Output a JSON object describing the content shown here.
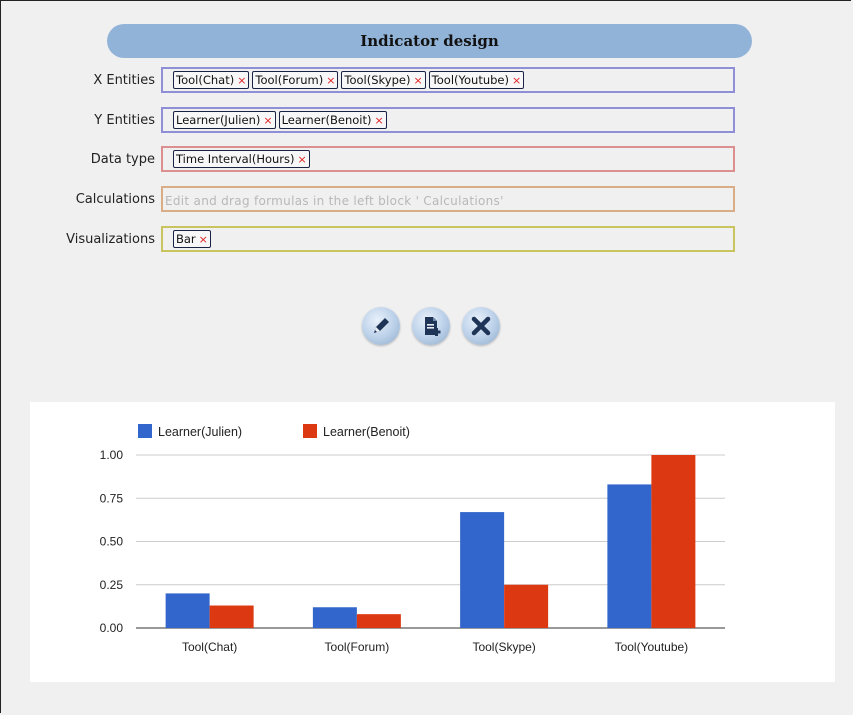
{
  "header": {
    "title": "Indicator design"
  },
  "form": {
    "x_entities": {
      "label": "X Entities",
      "tags": [
        "Tool(Chat)",
        "Tool(Forum)",
        "Tool(Skype)",
        "Tool(Youtube)"
      ]
    },
    "y_entities": {
      "label": "Y Entities",
      "tags": [
        "Learner(Julien)",
        "Learner(Benoit)"
      ]
    },
    "data_type": {
      "label": "Data type",
      "tags": [
        "Time Interval(Hours)"
      ]
    },
    "calculations": {
      "label": "Calculations",
      "placeholder": "Edit and drag formulas in the left block ' Calculations'"
    },
    "visualizations": {
      "label": "Visualizations",
      "tags": [
        "Bar"
      ]
    },
    "tag_remove_glyph": "×"
  },
  "actions": {
    "edit_icon": "pencil-icon",
    "save_icon": "document-add-icon",
    "delete_icon": "close-x-icon"
  },
  "colors": {
    "header_bg": "#92b3d8",
    "series_1": "#3366cc",
    "series_2": "#dc3912"
  },
  "chart_data": {
    "type": "bar",
    "categories": [
      "Tool(Chat)",
      "Tool(Forum)",
      "Tool(Skype)",
      "Tool(Youtube)"
    ],
    "series": [
      {
        "name": "Learner(Julien)",
        "values": [
          0.2,
          0.12,
          0.67,
          0.83
        ],
        "color": "#3366cc"
      },
      {
        "name": "Learner(Benoit)",
        "values": [
          0.13,
          0.08,
          0.25,
          1.0
        ],
        "color": "#dc3912"
      }
    ],
    "yticks": [
      "0.00",
      "0.25",
      "0.50",
      "0.75",
      "1.00"
    ],
    "ylim": [
      0,
      1
    ],
    "grid": true,
    "legend": "top-left"
  }
}
